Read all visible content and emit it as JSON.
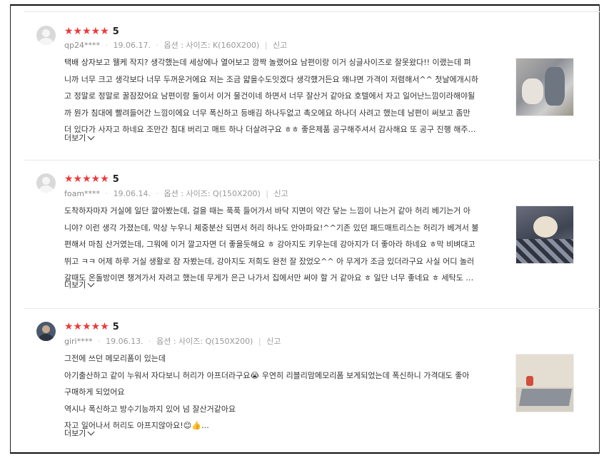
{
  "reviews": [
    {
      "stars": "★★★★★",
      "score": "5",
      "user": "qp24****",
      "date": "19.06.17.",
      "option": "옵션 : 사이즈: K(160X200)",
      "report": "신고",
      "lines": [
        "택배 상자보고 웰케 작지?  생각했는데 세상에나 열어보고 깜짝 놀랬어요 남편이랑 이거 싱글사이즈로 잘못왔다!! 이랬는데 펴",
        "니까 너무 크고 생각보다 너무 두꺼운거에요 저는 조금 얇을수도잇겠다 생각했거든요 왜냐면 가격이 저렴해서^^ 첫날에개시하",
        "고 정말로 정말로 꿀잠잤어요 남편이랑 둘이서 이거 물건이네 하면서 너무 잘산거 같아요 호텔에서 자고 일어난느낌이라해야될",
        "까 뭔가 침대에 빨려들어간 느낌이에요 너무 폭신하고 등배김 하나두없고 촉오에요 하나더 사려고 했는데 남편이 써보고 좀만",
        "더 있다가 사자고 하네요 조만간 침대 버리고 매트 하나 더살려구요 ㅎㅎ 좋은제품 공구해주셔서 감사해요 또 공구 진행 해주…"
      ],
      "more": "더보기"
    },
    {
      "stars": "★★★★★",
      "score": "5",
      "user": "foam****",
      "date": "19.06.14.",
      "option": "옵션 : 사이즈: Q(150X200)",
      "report": "신고",
      "lines": [
        "도착하자마자 거실에 일단 깔아봤는데, 걸을 때는 푹푹 들어가서 바닥 지면이 약간 닿는 느낌이 나는거 같아 허리 베기는거 아",
        "니야? 이런 생각 가졌는데, 막상 누우니 체중분산 되면서 허리 하나도 안아파요!^^기존 있던 패드매트리스는 허리가 베겨서 불",
        "편해서 마침 산거였는데, 그뭐에 이거 깔고자면 더 좋을듯해요 ㅎ 강아지도 키우는데 강아지가 더 좋아라 하네요 ㅎ막 비벼대고",
        "뛰고 ㅋㅋ 어제 하루 거실 생활로 잠 자봤는데, 강아지도 저희도 완전 잘 잤었오^^ 아 무게가 조금 있더라구요 사실 어디 놀러",
        "갈때도 온돌방이면 챙겨가서 자려고 했는데 무게가 은근 나가서 집에서만 써야 할 거 같아요 ㅎ 일단 너무 좋네요 ㅎ 세탁도 …"
      ],
      "more": "더보기"
    },
    {
      "stars": "★★★★★",
      "score": "5",
      "user": "giri****",
      "date": "19.06.13.",
      "option": "옵션 : 사이즈: Q(150X200)",
      "report": "신고",
      "lines": [
        "그전에 쓰던 메모리폼이 있는데",
        "아기출산하고 같이 누워서 자다보니 허리가 아프더라구요😭 우연히 리블리맘메모리폼 보게되었는데 폭신하니 가격대도 좋아",
        "구매하게 되었어요",
        "역시나 폭신하고 방수기능까지 있어 넘 잘산거같아요",
        "자고 일어나서 허리도 아프지않아요!😊👍…"
      ],
      "more": "더보기"
    }
  ]
}
